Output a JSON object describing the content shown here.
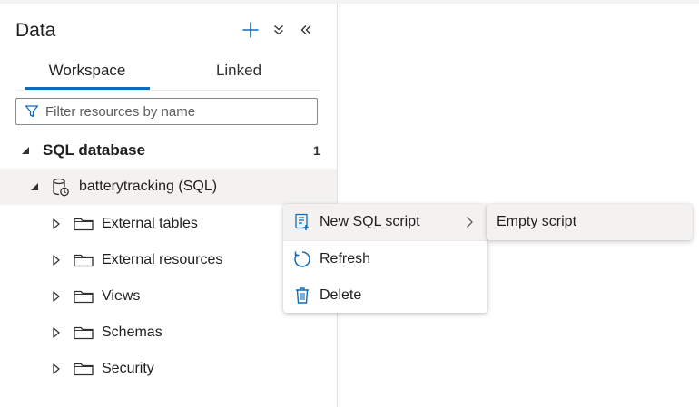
{
  "panel": {
    "title": "Data",
    "actions": [
      {
        "icon": "plus-icon",
        "color": "#0f6cbd"
      },
      {
        "icon": "double-chevron-down-icon"
      },
      {
        "icon": "double-chevron-left-icon"
      }
    ]
  },
  "tabs": [
    {
      "label": "Workspace",
      "selected": true
    },
    {
      "label": "Linked",
      "selected": false
    }
  ],
  "filter": {
    "placeholder": "Filter resources by name",
    "value": ""
  },
  "tree": {
    "group": {
      "label": "SQL database",
      "count": "1",
      "expanded": true
    },
    "database": {
      "label": "batterytracking (SQL)",
      "icon": "sql-database-icon",
      "expanded": true
    },
    "children": [
      {
        "label": "External tables",
        "icon": "folder-icon"
      },
      {
        "label": "External resources",
        "icon": "folder-icon"
      },
      {
        "label": "Views",
        "icon": "folder-icon"
      },
      {
        "label": "Schemas",
        "icon": "folder-icon"
      },
      {
        "label": "Security",
        "icon": "folder-icon"
      }
    ]
  },
  "context_menu": {
    "items": [
      {
        "label": "New SQL script",
        "icon": "sql-script-icon",
        "has_submenu": true
      },
      {
        "label": "Refresh",
        "icon": "refresh-icon"
      },
      {
        "label": "Delete",
        "icon": "trash-icon"
      }
    ],
    "submenu": [
      {
        "label": "Empty script"
      }
    ]
  },
  "colors": {
    "accent": "#0f6cbd",
    "hover": "#f3f2f1"
  }
}
